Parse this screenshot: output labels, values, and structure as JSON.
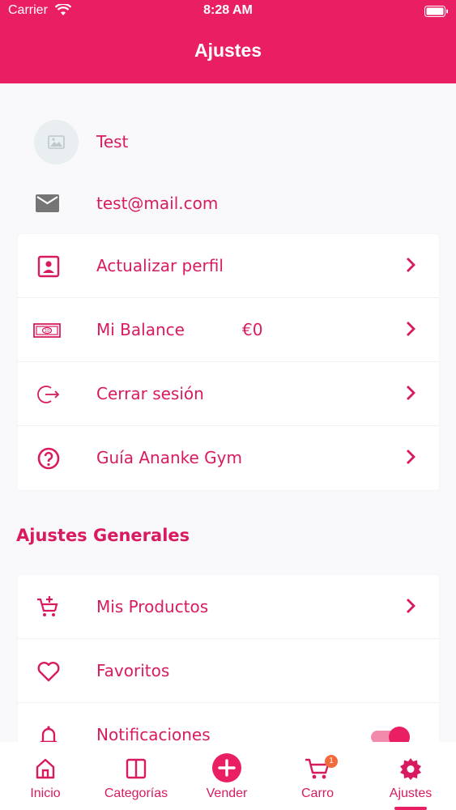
{
  "status_bar": {
    "carrier": "Carrier",
    "time": "8:28 AM"
  },
  "header": {
    "title": "Ajustes"
  },
  "profile": {
    "name": "Test",
    "email": "test@mail.com"
  },
  "account_items": [
    {
      "label": "Actualizar perfil",
      "icon": "profile-card-icon"
    },
    {
      "label": "Mi Balance",
      "value": "€0",
      "icon": "banknote-icon"
    },
    {
      "label": "Cerrar sesión",
      "icon": "logout-icon"
    },
    {
      "label": "Guía Ananke Gym",
      "icon": "help-icon"
    }
  ],
  "general_settings": {
    "title": "Ajustes Generales",
    "items": [
      {
        "label": "Mis Productos",
        "icon": "cart-add-icon"
      },
      {
        "label": "Favoritos",
        "icon": "heart-icon"
      },
      {
        "label": "Notificaciones",
        "icon": "bell-icon",
        "toggle_on": true
      }
    ]
  },
  "tabbar": {
    "tabs": [
      {
        "label": "Inicio",
        "icon": "home-icon"
      },
      {
        "label": "Categorías",
        "icon": "categories-icon"
      },
      {
        "label": "Vender",
        "icon": "add-circle-icon"
      },
      {
        "label": "Carro",
        "icon": "cart-icon",
        "badge": "1"
      },
      {
        "label": "Ajustes",
        "icon": "gear-icon",
        "active": true
      }
    ]
  },
  "colors": {
    "accent": "#ea1f63",
    "text_accent": "#d81b60",
    "background": "#f9f9fb"
  }
}
